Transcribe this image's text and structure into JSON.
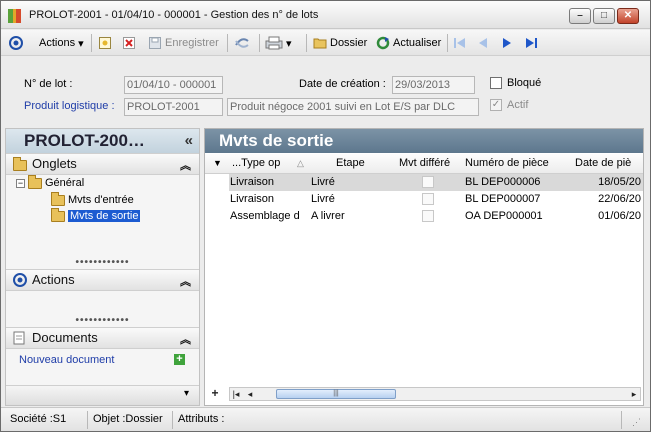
{
  "window": {
    "title": "PROLOT-2001 - 01/04/10 - 000001 -  Gestion des n° de lots",
    "controls": {
      "minimize": "–",
      "maximize": "□",
      "close": "✕"
    }
  },
  "toolbar": {
    "actions_label": "Actions",
    "save_label": "Enregistrer",
    "folder_label": "Dossier",
    "refresh_label": "Actualiser"
  },
  "form": {
    "lot_label": "N° de lot :",
    "lot_value": "01/04/10 - 000001",
    "date_label": "Date de création :",
    "date_value": "29/03/2013",
    "blocked_label": "Bloqué",
    "product_label": "Produit logistique :",
    "product_code": "PROLOT-2001",
    "product_desc": "Produit négoce 2001 suivi en Lot E/S par DLC",
    "active_label": "Actif"
  },
  "left_panel": {
    "title": "PROLOT-200…",
    "collapse_glyph": "«",
    "tabs_section": "Onglets",
    "tree": {
      "root": "Général",
      "children": [
        "Mvts d'entrée",
        "Mvts de sortie"
      ],
      "selected": "Mvts de sortie"
    },
    "actions_section": "Actions",
    "documents_section": "Documents",
    "new_document": "Nouveau document"
  },
  "right_panel": {
    "title": "Mvts de sortie",
    "columns": [
      "...Type op",
      "Etape",
      "Mvt différé",
      "Numéro de pièce",
      "Date de piè"
    ],
    "rows": [
      {
        "type": "Livraison",
        "etape": "Livré",
        "differe": false,
        "piece": "BL DEP000006",
        "date": "18/05/20"
      },
      {
        "type": "Livraison",
        "etape": "Livré",
        "differe": false,
        "piece": "BL DEP000007",
        "date": "22/06/20"
      },
      {
        "type": "Assemblage d",
        "etape": "A livrer",
        "differe": false,
        "piece": "OA DEP000001",
        "date": "01/06/20"
      }
    ]
  },
  "status": {
    "societe": "Société :S1",
    "objet": "Objet :Dossier",
    "attributs": "Attributs :"
  }
}
